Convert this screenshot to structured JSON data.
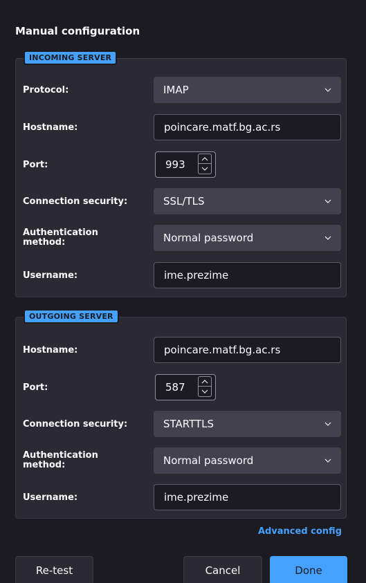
{
  "title": "Manual configuration",
  "incoming": {
    "legend": "INCOMING SERVER",
    "protocol_label": "Protocol:",
    "protocol_value": "IMAP",
    "hostname_label": "Hostname:",
    "hostname_value": "poincare.matf.bg.ac.rs",
    "port_label": "Port:",
    "port_value": "993",
    "security_label": "Connection security:",
    "security_value": "SSL/TLS",
    "auth_label_line1": "Authentication",
    "auth_label_line2": "method:",
    "auth_value": "Normal password",
    "username_label": "Username:",
    "username_value": "ime.prezime"
  },
  "outgoing": {
    "legend": "OUTGOING SERVER",
    "hostname_label": "Hostname:",
    "hostname_value": "poincare.matf.bg.ac.rs",
    "port_label": "Port:",
    "port_value": "587",
    "security_label": "Connection security:",
    "security_value": "STARTTLS",
    "auth_label_line1": "Authentication",
    "auth_label_line2": "method:",
    "auth_value": "Normal password",
    "username_label": "Username:",
    "username_value": "ime.prezime"
  },
  "advanced_link": "Advanced config",
  "buttons": {
    "retest": "Re-test",
    "cancel": "Cancel",
    "done": "Done"
  },
  "icons": {
    "dropdown": "chevron-down-icon",
    "spin_up": "chevron-up-icon",
    "spin_down": "chevron-down-icon"
  },
  "colors": {
    "accent": "#45a1ff",
    "background": "#1c1b22",
    "panel": "#2b2a33",
    "control": "#42414d"
  }
}
